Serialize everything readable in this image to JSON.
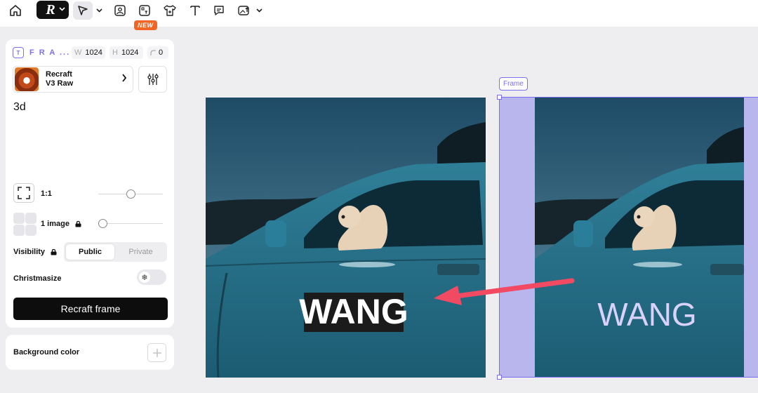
{
  "toolbar": {
    "new_badge": "NEW",
    "icons": [
      "home-icon",
      "recraft-logo-icon",
      "select-tool-icon",
      "image-icon",
      "text-to-image-icon",
      "mockup-shirt-icon",
      "text-tool-icon",
      "comment-icon",
      "image-edit-icon"
    ]
  },
  "frame_settings": {
    "name": "F R A ...",
    "width_label": "W",
    "width": "1024",
    "height_label": "H",
    "height": "1024",
    "radius": "0"
  },
  "model": {
    "name_line1": "Recraft",
    "name_line2": "V3 Raw"
  },
  "prompt": "3d",
  "aspect_ratio": {
    "label": "1:1",
    "slider_value": 0.5
  },
  "image_count": {
    "label": "1 image",
    "slider_value": 0.0
  },
  "visibility": {
    "label": "Visibility",
    "options": [
      "Public",
      "Private"
    ],
    "selected": "Public"
  },
  "christmasize": {
    "label": "Christmasize",
    "enabled": false
  },
  "recraft_button": "Recraft frame",
  "background": {
    "label": "Background color"
  },
  "canvas": {
    "frame_label": "Frame",
    "left_image_text": "WANG",
    "right_image_text": "WANG"
  },
  "colors": {
    "accent": "#7b6ff0",
    "frame_fill": "#b9b6ee",
    "arrow": "#f24a63",
    "new_badge": "#f26522"
  }
}
